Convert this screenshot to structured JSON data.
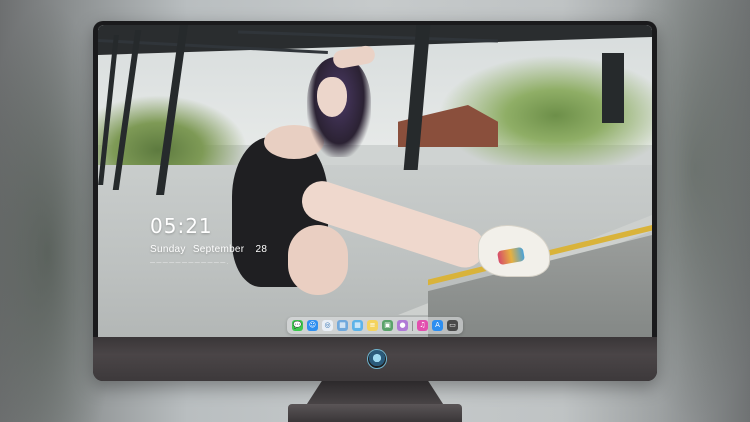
{
  "desktop": {
    "clock": {
      "time": "05:21",
      "weekday": "Sunday",
      "month": "September",
      "day": "28",
      "quote": "— — — — — — — — — — — — ."
    },
    "dock": {
      "apps": [
        {
          "name": "messages-icon",
          "color": "#3cc84e",
          "glyph": "💬"
        },
        {
          "name": "finder-icon",
          "color": "#2f8ff0",
          "glyph": "☺"
        },
        {
          "name": "safari-icon",
          "color": "#e8eef5",
          "glyph": "◎"
        },
        {
          "name": "preview-icon",
          "color": "#6fa8dc",
          "glyph": "▦"
        },
        {
          "name": "launchpad-icon",
          "color": "#5cb3e8",
          "glyph": "▦"
        },
        {
          "name": "notes-icon",
          "color": "#f4d35e",
          "glyph": "≡"
        },
        {
          "name": "photos-icon",
          "color": "#5aa36a",
          "glyph": "▣"
        },
        {
          "name": "contacts-icon",
          "color": "#b07ad6",
          "glyph": "●"
        },
        {
          "name": "music-icon",
          "color": "#e24fae",
          "glyph": "♫"
        },
        {
          "name": "appstore-icon",
          "color": "#2d8ef0",
          "glyph": "A"
        },
        {
          "name": "camera-icon",
          "color": "#4a4a4a",
          "glyph": "▭"
        }
      ]
    }
  },
  "monitor": {
    "brand_logo": "monitor-logo-icon"
  }
}
